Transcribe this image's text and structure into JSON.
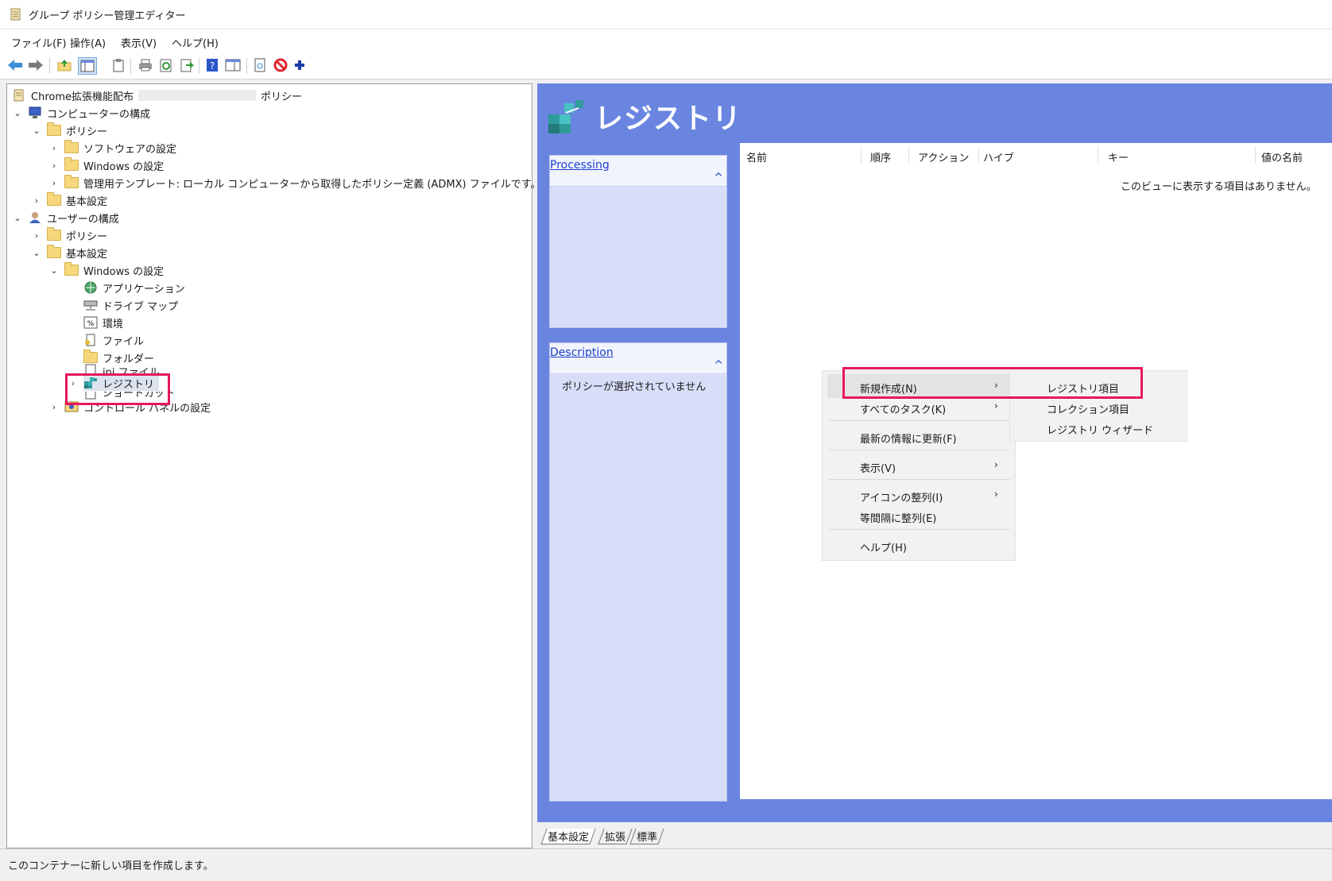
{
  "window": {
    "title": "グループ ポリシー管理エディター"
  },
  "menu": [
    "ファイル(F)",
    "操作(A)",
    "表示(V)",
    "ヘルプ(H)"
  ],
  "tree": {
    "root": {
      "label_left": "Chrome拡張機能配布",
      "label_right": "ポリシー"
    },
    "computer_config": "コンピューターの構成",
    "policies": "ポリシー",
    "software_settings": "ソフトウェアの設定",
    "windows_settings": "Windows の設定",
    "admin_templates": "管理用テンプレート: ローカル コンピューターから取得したポリシー定義 (ADMX) ファイルです。",
    "preferences": "基本設定",
    "user_config": "ユーザーの構成",
    "user_policies": "ポリシー",
    "user_preferences": "基本設定",
    "user_windows_settings": "Windows の設定",
    "applications": "アプリケーション",
    "drive_maps": "ドライブ マップ",
    "environment": "環境",
    "files": "ファイル",
    "folders": "フォルダー",
    "ini_files": "ini ファイル",
    "registry": "レジストリ",
    "shortcuts": "ショートカット",
    "control_panel": "コントロール パネルの設定"
  },
  "status": "このコンテナーに新しい項目を作成します。",
  "right": {
    "title": "レジストリ",
    "processing_link": "Processing",
    "description_link": "Description",
    "description_text": "ポリシーが選択されていません",
    "columns": [
      "名前",
      "順序",
      "アクション",
      "ハイブ",
      "キー",
      "値の名前"
    ],
    "empty_message": "このビューに表示する項目はありません。"
  },
  "context_menu": {
    "new": "新規作成(N)",
    "all_tasks": "すべてのタスク(K)",
    "refresh": "最新の情報に更新(F)",
    "view": "表示(V)",
    "arrange_icons": "アイコンの整列(I)",
    "line_up": "等間隔に整列(E)",
    "help": "ヘルプ(H)"
  },
  "submenu": [
    "レジストリ項目",
    "コレクション項目",
    "レジストリ ウィザード"
  ],
  "tabs": [
    "基本設定",
    "拡張",
    "標準"
  ],
  "colors": {
    "accent_blue": "#6a85e0",
    "highlight": "#e6175f"
  }
}
